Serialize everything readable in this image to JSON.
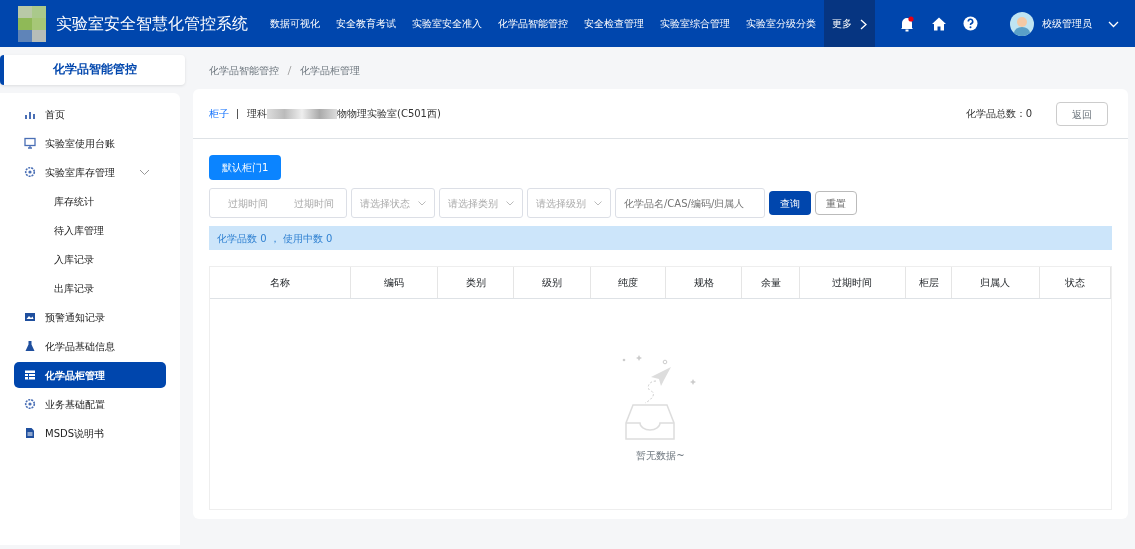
{
  "header": {
    "title": "实验室安全智慧化管控系统",
    "nav": [
      {
        "label": "数据可视化",
        "selected": false
      },
      {
        "label": "安全教育考试",
        "selected": false
      },
      {
        "label": "实验室安全准入",
        "selected": false
      },
      {
        "label": "化学品智能管控",
        "selected": false
      },
      {
        "label": "安全检查管理",
        "selected": false
      },
      {
        "label": "实验室综合管理",
        "selected": false
      },
      {
        "label": "实验室分级分类",
        "selected": false
      },
      {
        "label": "更多",
        "selected": true
      }
    ],
    "notification_dot": true,
    "user": "校级管理员"
  },
  "sidebar": {
    "title": "化学品智能管控",
    "items": [
      {
        "label": "首页",
        "selected": false
      },
      {
        "label": "实验室使用台账",
        "selected": false
      },
      {
        "label": "实验室库存管理",
        "selected": false,
        "expanded": true,
        "children": [
          {
            "label": "库存统计",
            "selected": false
          },
          {
            "label": "待入库管理",
            "selected": false
          },
          {
            "label": "入库记录",
            "selected": false
          },
          {
            "label": "出库记录",
            "selected": false
          }
        ]
      },
      {
        "label": "预警通知记录",
        "selected": false
      },
      {
        "label": "化学品基础信息",
        "selected": false
      },
      {
        "label": "化学品柜管理",
        "selected": true
      },
      {
        "label": "业务基础配置",
        "selected": false
      },
      {
        "label": "MSDS说明书",
        "selected": false
      }
    ]
  },
  "breadcrumb": [
    "化学品智能管控",
    "化学品柜管理"
  ],
  "panel": {
    "cabinet_label": "柜子",
    "location_start": "理科",
    "location_end": "物物理实验室(C501西)",
    "total": "化学品总数：0",
    "back_button": "返回",
    "door_tabs": [
      {
        "label": "默认柜门1",
        "selected": true
      }
    ],
    "filters": {
      "date_range": [
        {
          "placeholder": "过期时间"
        },
        {
          "placeholder": "过期时间"
        }
      ],
      "selects": [
        "请选择状态",
        "请选择类别",
        "请选择级别"
      ],
      "search_placeholder": "化学品名/CAS/编码/归属人",
      "query_button": "查询",
      "reset_button": "重置"
    },
    "summary": "化学品数 0 ，  使用中数 0",
    "columns": [
      "名称",
      "编码",
      "类别",
      "级别",
      "纯度",
      "规格",
      "余量",
      "过期时间",
      "柜层",
      "归属人",
      "状态"
    ],
    "empty_text": "暂无数据~"
  }
}
